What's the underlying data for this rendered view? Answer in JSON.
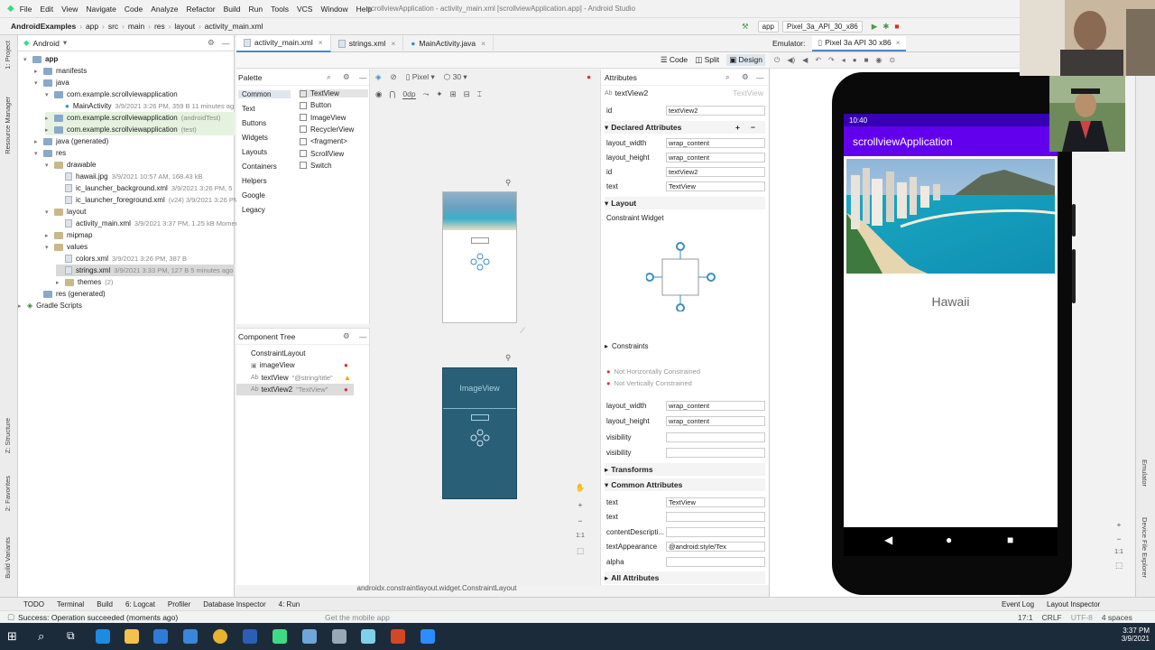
{
  "menu": [
    "File",
    "Edit",
    "View",
    "Navigate",
    "Code",
    "Analyze",
    "Refactor",
    "Build",
    "Run",
    "Tools",
    "VCS",
    "Window",
    "Help"
  ],
  "window_title": "scrollviewApplication - activity_main.xml [scrollviewApplication.app] - Android Studio",
  "breadcrumb": [
    "AndroidExamples",
    "app",
    "src",
    "main",
    "res",
    "layout",
    "activity_main.xml"
  ],
  "run_config": "app",
  "device_selector": "Pixel_3a_API_30_x86",
  "project_panel": {
    "view_mode": "Android",
    "tree": [
      {
        "label": "app",
        "meta": ""
      },
      {
        "label": "manifests",
        "meta": ""
      },
      {
        "label": "java",
        "meta": ""
      },
      {
        "label": "com.example.scrollviewapplication",
        "meta": ""
      },
      {
        "label": "MainActivity",
        "meta": "3/9/2021 3:26 PM, 359 B 11 minutes ag"
      },
      {
        "label": "com.example.scrollviewapplication",
        "meta": "(androidTest)"
      },
      {
        "label": "com.example.scrollviewapplication",
        "meta": "(test)"
      },
      {
        "label": "java (generated)",
        "meta": ""
      },
      {
        "label": "res",
        "meta": ""
      },
      {
        "label": "drawable",
        "meta": ""
      },
      {
        "label": "hawaii.jpg",
        "meta": "3/9/2021 10:57 AM, 168.43 kB"
      },
      {
        "label": "ic_launcher_background.xml",
        "meta": "3/9/2021 3:26 PM, 5"
      },
      {
        "label": "ic_launcher_foreground.xml",
        "meta": "(v24) 3/9/2021 3:26 PM"
      },
      {
        "label": "layout",
        "meta": ""
      },
      {
        "label": "activity_main.xml",
        "meta": "3/9/2021 3:37 PM, 1.25 kB Momer"
      },
      {
        "label": "mipmap",
        "meta": ""
      },
      {
        "label": "values",
        "meta": ""
      },
      {
        "label": "colors.xml",
        "meta": "3/9/2021 3:26 PM, 387 B"
      },
      {
        "label": "strings.xml",
        "meta": "3/9/2021 3:33 PM, 127 B 5 minutes ago"
      },
      {
        "label": "themes",
        "meta": "(2)"
      },
      {
        "label": "res (generated)",
        "meta": ""
      },
      {
        "label": "Gradle Scripts",
        "meta": ""
      }
    ]
  },
  "editor_tabs": [
    "activity_main.xml",
    "strings.xml",
    "MainActivity.java"
  ],
  "view_modes": [
    "Code",
    "Split",
    "Design"
  ],
  "emulator_label": "Emulator:",
  "emulator_device": "Pixel 3a API 30 x86",
  "palette": {
    "title": "Palette",
    "categories": [
      "Common",
      "Text",
      "Buttons",
      "Widgets",
      "Layouts",
      "Containers",
      "Helpers",
      "Google",
      "Legacy"
    ],
    "items": [
      "TextView",
      "Button",
      "ImageView",
      "RecyclerView",
      "<fragment>",
      "ScrollView",
      "Switch"
    ]
  },
  "design_toolbar": {
    "device": "Pixel",
    "api": "30",
    "margin": "0dp"
  },
  "component_tree": {
    "title": "Component Tree",
    "items": [
      {
        "label": "ConstraintLayout",
        "hint": ""
      },
      {
        "label": "imageView",
        "hint": ""
      },
      {
        "label": "textView",
        "hint": "\"@string/title\""
      },
      {
        "label": "textView2",
        "hint": "\"TextView\""
      }
    ]
  },
  "blueprint_label": "ImageView",
  "canvas_footer": "androidx.constraintlayout.widget.ConstraintLayout",
  "attributes": {
    "title": "Attributes",
    "widget": "textView2",
    "widget_type": "TextView",
    "id_label": "id",
    "id_value": "textView2",
    "declared_title": "Declared Attributes",
    "declared": [
      {
        "k": "layout_width",
        "v": "wrap_content"
      },
      {
        "k": "layout_height",
        "v": "wrap_content"
      },
      {
        "k": "id",
        "v": "textView2"
      },
      {
        "k": "text",
        "v": "TextView"
      }
    ],
    "layout_title": "Layout",
    "constraint_widget": "Constraint Widget",
    "constraints_title": "Constraints",
    "warnings": [
      "Not Horizontally Constrained",
      "Not Vertically Constrained"
    ],
    "layout_rows": [
      {
        "k": "layout_width",
        "v": "wrap_content"
      },
      {
        "k": "layout_height",
        "v": "wrap_content"
      },
      {
        "k": "visibility",
        "v": ""
      },
      {
        "k": "visibility",
        "v": ""
      }
    ],
    "transforms_title": "Transforms",
    "common_title": "Common Attributes",
    "common_rows": [
      {
        "k": "text",
        "v": "TextView"
      },
      {
        "k": "text",
        "v": ""
      },
      {
        "k": "contentDescripti...",
        "v": ""
      },
      {
        "k": "textAppearance",
        "v": "@android:style/Tex"
      },
      {
        "k": "alpha",
        "v": ""
      }
    ],
    "all_title": "All Attributes"
  },
  "phone": {
    "time": "10:40",
    "app_title": "scrollviewApplication",
    "text": "Hawaii"
  },
  "bottom_tabs": [
    "TODO",
    "Terminal",
    "Build",
    "6: Logcat",
    "Profiler",
    "Database Inspector",
    "4: Run"
  ],
  "bottom_right_tabs": [
    "Event Log",
    "Layout Inspector"
  ],
  "status_message": "Success: Operation succeeded (moments ago)",
  "caption": "Get the mobile app",
  "status_right": {
    "pos": "17:1",
    "eol": "CRLF",
    "enc": "UTF-8",
    "indent": "4 spaces"
  },
  "clock": {
    "time": "3:37 PM",
    "date": "3/9/2021"
  },
  "side_tabs_left": [
    "1: Project",
    "Resource Manager",
    "Z: Structure",
    "2: Favorites",
    "Build Variants"
  ],
  "side_tabs_right": [
    "Emulator",
    "Device File Explorer"
  ],
  "colors": {
    "accent": "#6200ee",
    "status": "#3700b3",
    "blueprint": "#2a5f78"
  }
}
